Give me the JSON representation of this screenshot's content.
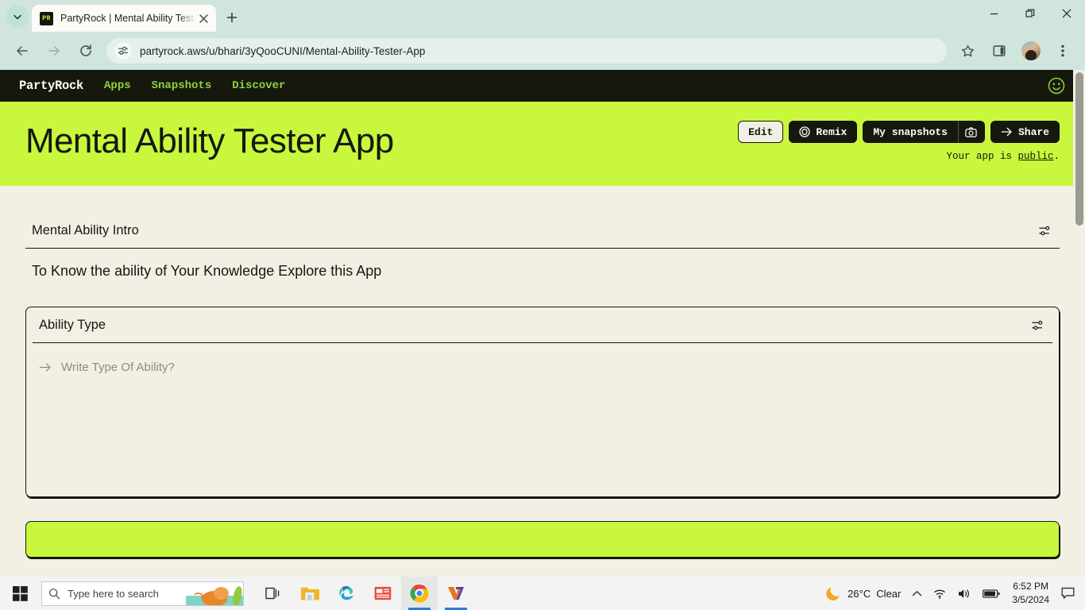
{
  "browser": {
    "tab": {
      "title": "PartyRock | Mental Ability Teste",
      "favicon_text": "PR",
      "favicon_icon": "partyrock-favicon"
    },
    "new_tab_icon": "plus-icon",
    "tab_close_icon": "close-icon",
    "tab_list_icon": "chevron-down-icon",
    "back_icon": "back-arrow-icon",
    "forward_icon": "forward-arrow-icon",
    "reload_icon": "reload-icon",
    "site_info_icon": "site-settings-icon",
    "url": "partyrock.aws/u/bhari/3yQooCUNI/Mental-Ability-Tester-App",
    "bookmark_icon": "star-icon",
    "side_panel_icon": "side-panel-icon",
    "profile_icon": "avatar",
    "menu_icon": "three-dot-menu-icon",
    "minimize_icon": "minimize-icon",
    "maximize_icon": "maximize-icon",
    "close_icon": "window-close-icon"
  },
  "partyrock_nav": {
    "logo": "PartyRock",
    "links": [
      "Apps",
      "Snapshots",
      "Discover"
    ],
    "profile_icon": "smiley-face-icon"
  },
  "app_header": {
    "title": "Mental Ability Tester App",
    "edit_label": "Edit",
    "remix_label": "Remix",
    "remix_icon": "remix-circle-icon",
    "snapshots_label": "My snapshots",
    "camera_icon": "camera-icon",
    "share_label": "Share",
    "share_icon": "arrow-right-icon",
    "visibility_prefix": "Your app is ",
    "visibility_value": "public",
    "visibility_suffix": "."
  },
  "widgets": {
    "intro": {
      "title": "Mental Ability Intro",
      "body": "To Know the ability of Your Knowledge Explore this App",
      "settings_icon": "sliders-icon"
    },
    "ability_type": {
      "title": "Ability Type",
      "placeholder": "Write Type Of Ability?",
      "arrow_icon": "arrow-right-icon",
      "settings_icon": "sliders-icon"
    }
  },
  "taskbar": {
    "start_icon": "windows-start-icon",
    "search_placeholder": "Type here to search",
    "search_icon": "search-icon",
    "apps": [
      {
        "name": "task-view",
        "icon": "task-view-icon"
      },
      {
        "name": "file-explorer",
        "icon": "folder-icon"
      },
      {
        "name": "microsoft-edge",
        "icon": "edge-icon"
      },
      {
        "name": "news-widget",
        "icon": "news-icon"
      },
      {
        "name": "google-chrome",
        "icon": "chrome-icon"
      },
      {
        "name": "v7-app",
        "icon": "v7-icon"
      }
    ],
    "tray": {
      "weather_icon": "moon-icon",
      "temperature": "26°C",
      "condition": "Clear",
      "overflow_icon": "chevron-up-icon",
      "wifi_icon": "wifi-icon",
      "volume_icon": "speaker-icon",
      "battery_icon": "battery-icon",
      "time": "6:52 PM",
      "date": "3/5/2024",
      "notification_icon": "notification-icon"
    }
  },
  "colors": {
    "lime": "#C8F73E",
    "cream": "#F2F0E4",
    "ink": "#16180E",
    "nav_green": "#8FD43A"
  }
}
